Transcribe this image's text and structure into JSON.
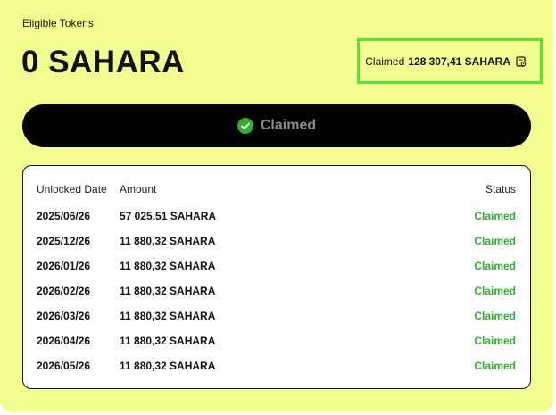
{
  "eligible": {
    "label": "Eligible Tokens",
    "amount": "0 SAHARA"
  },
  "claimed_summary": {
    "label": "Claimed",
    "value": "128 307,41 SAHARA",
    "icon": "document-icon"
  },
  "claim_button": {
    "label": "Claimed",
    "icon": "check-circle-icon",
    "icon_color": "#2eaf2e"
  },
  "schedule": {
    "headers": {
      "date": "Unlocked Date",
      "amount": "Amount",
      "status": "Status"
    },
    "rows": [
      {
        "date": "2025/06/26",
        "amount": "57 025,51 SAHARA",
        "status": "Claimed"
      },
      {
        "date": "2025/12/26",
        "amount": "11 880,32 SAHARA",
        "status": "Claimed"
      },
      {
        "date": "2026/01/26",
        "amount": "11 880,32 SAHARA",
        "status": "Claimed"
      },
      {
        "date": "2026/02/26",
        "amount": "11 880,32 SAHARA",
        "status": "Claimed"
      },
      {
        "date": "2026/03/26",
        "amount": "11 880,32 SAHARA",
        "status": "Claimed"
      },
      {
        "date": "2026/04/26",
        "amount": "11 880,32 SAHARA",
        "status": "Claimed"
      },
      {
        "date": "2026/05/26",
        "amount": "11 880,32 SAHARA",
        "status": "Claimed"
      }
    ]
  },
  "colors": {
    "card_background": "#f3fd8f",
    "highlight_border": "#5ee22f",
    "status_green": "#2eaf2e",
    "button_background": "#020202"
  }
}
